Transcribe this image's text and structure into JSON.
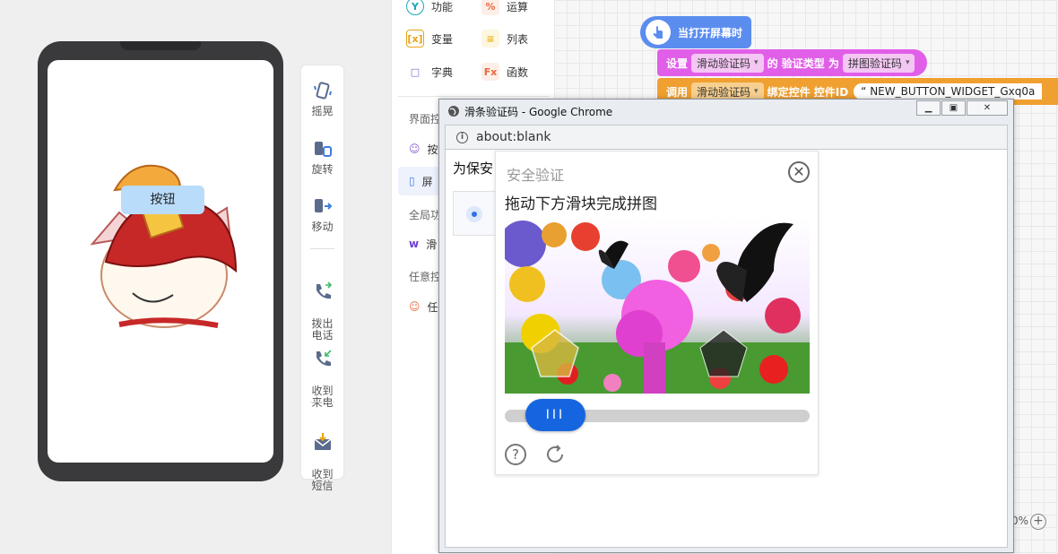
{
  "simulator": {
    "phone_button_label": "按钮",
    "toolbar": [
      {
        "icon": "shake-icon",
        "label": "摇晃"
      },
      {
        "icon": "rotate-icon",
        "label": "旋转"
      },
      {
        "icon": "move-icon",
        "label": "移动"
      },
      {
        "icon": "phone-out-icon",
        "label": "拨出\n电话"
      },
      {
        "icon": "phone-in-icon",
        "label": "收到\n来电"
      },
      {
        "icon": "sms-icon",
        "label": "收到\n短信"
      }
    ]
  },
  "palette": {
    "items": [
      {
        "label": "功能",
        "icon": "Y",
        "color": "#18a9b8"
      },
      {
        "label": "运算",
        "icon": "%",
        "color": "#e86a3c"
      },
      {
        "label": "变量",
        "icon": "[x]",
        "color": "#e8a317"
      },
      {
        "label": "列表",
        "icon": "≡",
        "color": "#e8b417"
      },
      {
        "label": "字典",
        "icon": "□",
        "color": "#8a63d2"
      },
      {
        "label": "函数",
        "icon": "Fx",
        "color": "#e86a3c"
      }
    ],
    "sections": [
      "界面控",
      "全局功",
      "任意控"
    ],
    "rows": [
      {
        "label": "按",
        "color": "#8a63d2"
      },
      {
        "label": "屏",
        "color": "#3f7de0"
      },
      {
        "label": "滑",
        "color": "#6a3fd2"
      },
      {
        "label": "任",
        "color": "#e86a3c"
      }
    ]
  },
  "blocks": {
    "event": "当打开屏幕时",
    "set_row": {
      "prefix": "设置",
      "target": "滑动验证码",
      "middle": "的 验证类型 为",
      "value": "拼图验证码"
    },
    "call_row": {
      "prefix": "调用",
      "target": "滑动验证码",
      "middle": "绑定控件 控件ID",
      "value": "NEW_BUTTON_WIDGET_Gxq0a"
    }
  },
  "workspace": {
    "zoom": "0%"
  },
  "chrome": {
    "title": "滑条验证码 - Google Chrome",
    "url": "about:blank",
    "page_text": "为保安"
  },
  "captcha": {
    "title": "安全验证",
    "hint": "拖动下方滑块完成拼图",
    "handle": "III",
    "progress": 0.07
  },
  "colors": {
    "event_block": "#5b8def",
    "set_block": "#e15fe8",
    "call_block": "#f0a030",
    "slider": "#1665e0"
  }
}
